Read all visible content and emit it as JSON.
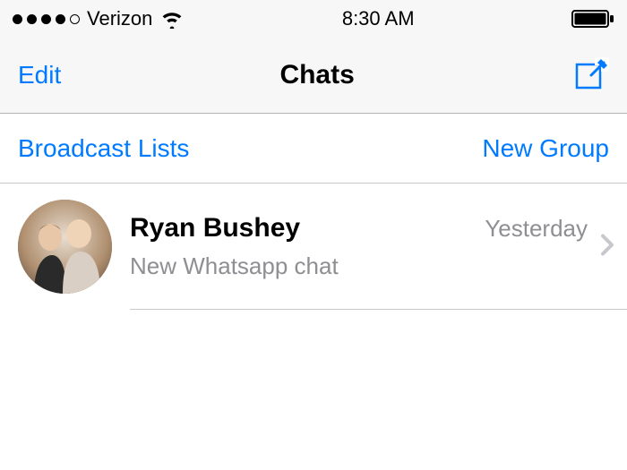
{
  "status": {
    "carrier": "Verizon",
    "time": "8:30 AM",
    "signal_filled": 4,
    "signal_total": 5
  },
  "nav": {
    "left_label": "Edit",
    "title": "Chats",
    "compose_icon": "compose"
  },
  "subheader": {
    "left": "Broadcast Lists",
    "right": "New Group"
  },
  "chats": [
    {
      "name": "Ryan Bushey",
      "time": "Yesterday",
      "preview": "New Whatsapp chat"
    }
  ],
  "colors": {
    "tint": "#007aff",
    "gray": "#8e8e93",
    "separator": "#c8c7cc"
  }
}
